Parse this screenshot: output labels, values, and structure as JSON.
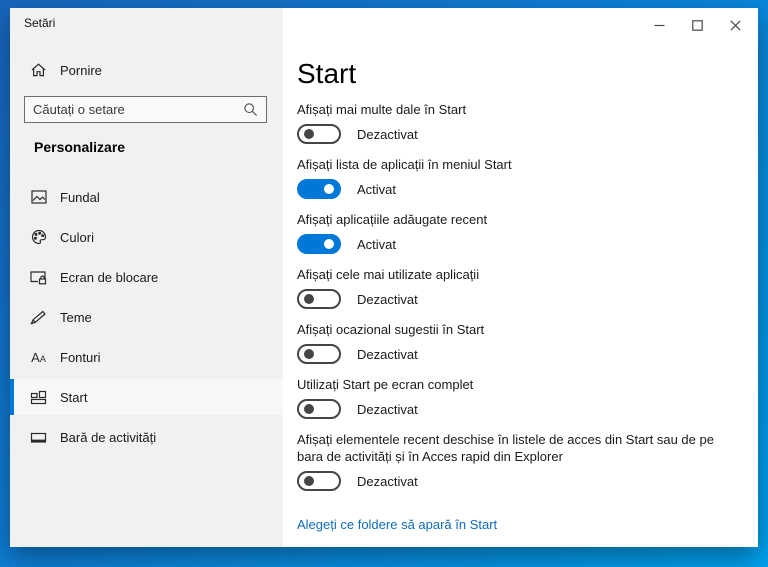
{
  "window": {
    "title": "Setări",
    "controls": [
      {
        "name": "minimize-icon"
      },
      {
        "name": "maximize-icon"
      },
      {
        "name": "close-icon"
      }
    ]
  },
  "sidebar": {
    "home": {
      "label": "Pornire",
      "icon": "home-icon"
    },
    "search": {
      "placeholder": "Căutați o setare",
      "icon": "search-icon"
    },
    "section_heading": "Personalizare",
    "items": [
      {
        "label": "Fundal",
        "icon": "background-image-icon",
        "selected": false
      },
      {
        "label": "Culori",
        "icon": "palette-icon",
        "selected": false
      },
      {
        "label": "Ecran de blocare",
        "icon": "lock-screen-icon",
        "selected": false
      },
      {
        "label": "Teme",
        "icon": "themes-icon",
        "selected": false
      },
      {
        "label": "Fonturi",
        "icon": "fonts-icon",
        "selected": false
      },
      {
        "label": "Start",
        "icon": "start-tiles-icon",
        "selected": true
      },
      {
        "label": "Bară de activități",
        "icon": "taskbar-icon",
        "selected": false
      }
    ]
  },
  "main": {
    "title": "Start",
    "settings": [
      {
        "label": "Afișați mai multe dale în Start",
        "state": "off",
        "status": "Dezactivat"
      },
      {
        "label": "Afișați lista de aplicații în meniul Start",
        "state": "on",
        "status": "Activat"
      },
      {
        "label": "Afișați aplicațiile adăugate recent",
        "state": "on",
        "status": "Activat"
      },
      {
        "label": "Afișați cele mai utilizate aplicații",
        "state": "off",
        "status": "Dezactivat"
      },
      {
        "label": "Afișați ocazional sugestii în Start",
        "state": "off",
        "status": "Dezactivat"
      },
      {
        "label": "Utilizați Start pe ecran complet",
        "state": "off",
        "status": "Dezactivat"
      },
      {
        "label": "Afișați elementele recent deschise în listele de acces din Start sau de pe bara de activități și în Acces rapid din Explorer",
        "state": "off",
        "status": "Dezactivat"
      }
    ],
    "link": "Alegeți ce foldere să apară în Start"
  },
  "colors": {
    "accent": "#0078d7",
    "link": "#0f6cbd",
    "sidebar_bg": "#f1f1f1",
    "window_bg": "#ffffff",
    "desktop_blue": "#0d7fd6"
  }
}
